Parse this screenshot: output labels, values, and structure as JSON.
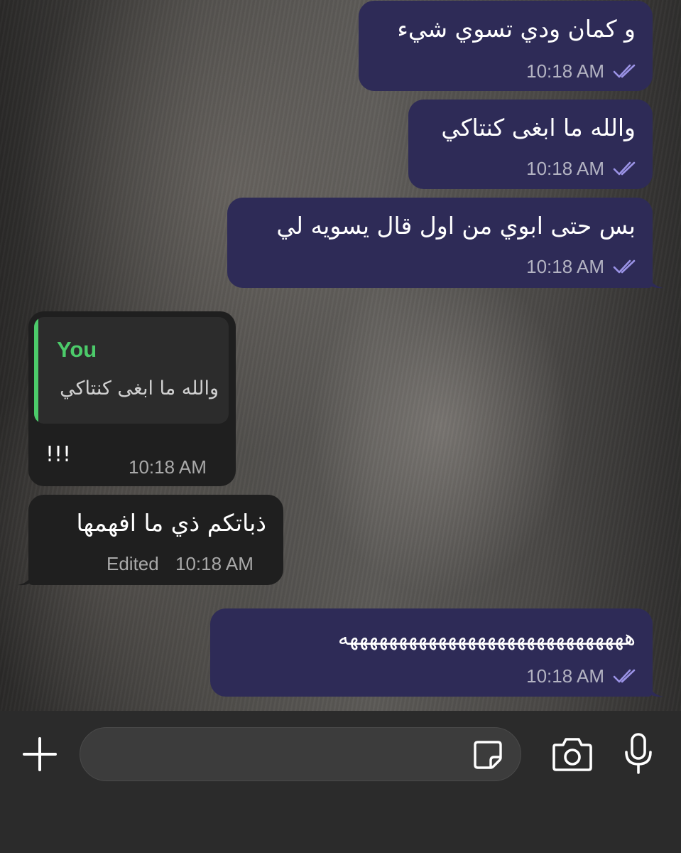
{
  "conversation": {
    "messages": [
      {
        "direction": "outgoing",
        "text": "و كمان ودي تسوي شيء",
        "time": "10:18 AM",
        "status": "read"
      },
      {
        "direction": "outgoing",
        "text": "والله ما ابغى كنتاكي",
        "time": "10:18 AM",
        "status": "read"
      },
      {
        "direction": "outgoing",
        "text": "بس حتى ابوي من اول قال يسويه لي",
        "time": "10:18 AM",
        "status": "read"
      },
      {
        "direction": "incoming",
        "text": "!!!",
        "time": "10:18 AM",
        "reply": {
          "author": "You",
          "text": "والله ما ابغى كنتاكي"
        }
      },
      {
        "direction": "incoming",
        "text": "ذباتكم ذي ما افهمها",
        "time": "10:18 AM",
        "edited_label": "Edited"
      },
      {
        "direction": "outgoing",
        "text": "هههههههههههههههههههههههههههههه",
        "time": "10:18 AM",
        "status": "read"
      }
    ]
  },
  "composer": {
    "placeholder": "",
    "value": "",
    "icons": {
      "attach": "plus-icon",
      "sticker": "sticker-icon",
      "camera": "camera-icon",
      "voice": "microphone-icon"
    }
  },
  "colors": {
    "outgoing_bubble": "#2e2b57",
    "incoming_bubble": "#1f1f1f",
    "read_ticks": "#9b93e6",
    "reply_accent": "#4ccb6a",
    "composer_bg": "#2b2b2b"
  }
}
